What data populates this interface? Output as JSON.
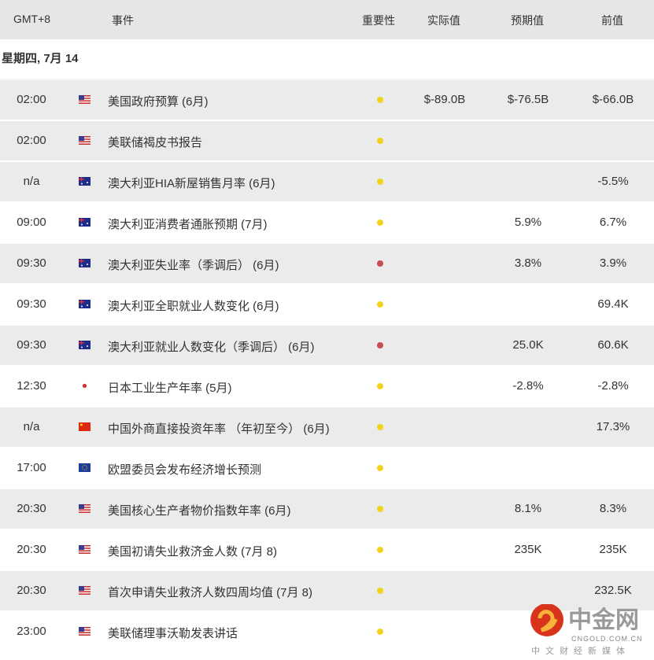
{
  "header": {
    "tz": "GMT+8",
    "event": "事件",
    "importance": "重要性",
    "actual": "实际值",
    "forecast": "预期值",
    "previous": "前值"
  },
  "date": "星期四, 7月 14",
  "colors": {
    "low": "#f2d21a",
    "high": "#c44d4d",
    "row_gray": "#ebebeb"
  },
  "rows": [
    {
      "time": "02:00",
      "flag": "us",
      "event": "美国政府预算 (6月)",
      "imp": "low",
      "actual": "$-89.0B",
      "forecast": "$-76.5B",
      "previous": "$-66.0B",
      "bg": "g"
    },
    {
      "time": "02:00",
      "flag": "us",
      "event": "美联储褐皮书报告",
      "imp": "low",
      "actual": "",
      "forecast": "",
      "previous": "",
      "bg": "g"
    },
    {
      "time": "n/a",
      "flag": "au",
      "event": "澳大利亚HIA新屋销售月率 (6月)",
      "imp": "low",
      "actual": "",
      "forecast": "",
      "previous": "-5.5%",
      "bg": "g"
    },
    {
      "time": "09:00",
      "flag": "au",
      "event": "澳大利亚消费者通胀预期 (7月)",
      "imp": "low",
      "actual": "",
      "forecast": "5.9%",
      "previous": "6.7%",
      "bg": "w"
    },
    {
      "time": "09:30",
      "flag": "au",
      "event": "澳大利亚失业率（季调后） (6月)",
      "imp": "high",
      "actual": "",
      "forecast": "3.8%",
      "previous": "3.9%",
      "bg": "g"
    },
    {
      "time": "09:30",
      "flag": "au",
      "event": "澳大利亚全职就业人数变化 (6月)",
      "imp": "low",
      "actual": "",
      "forecast": "",
      "previous": "69.4K",
      "bg": "w"
    },
    {
      "time": "09:30",
      "flag": "au",
      "event": "澳大利亚就业人数变化（季调后） (6月)",
      "imp": "high",
      "actual": "",
      "forecast": "25.0K",
      "previous": "60.6K",
      "bg": "g"
    },
    {
      "time": "12:30",
      "flag": "jp",
      "event": "日本工业生产年率 (5月)",
      "imp": "low",
      "actual": "",
      "forecast": "-2.8%",
      "previous": "-2.8%",
      "bg": "w"
    },
    {
      "time": "n/a",
      "flag": "cn",
      "event": "中国外商直接投资年率 （年初至今） (6月)",
      "imp": "low",
      "actual": "",
      "forecast": "",
      "previous": "17.3%",
      "bg": "g"
    },
    {
      "time": "17:00",
      "flag": "eu",
      "event": "欧盟委员会发布经济增长预测",
      "imp": "low",
      "actual": "",
      "forecast": "",
      "previous": "",
      "bg": "w"
    },
    {
      "time": "20:30",
      "flag": "us",
      "event": "美国核心生产者物价指数年率 (6月)",
      "imp": "low",
      "actual": "",
      "forecast": "8.1%",
      "previous": "8.3%",
      "bg": "g"
    },
    {
      "time": "20:30",
      "flag": "us",
      "event": "美国初请失业救济金人数 (7月 8)",
      "imp": "low",
      "actual": "",
      "forecast": "235K",
      "previous": "235K",
      "bg": "w"
    },
    {
      "time": "20:30",
      "flag": "us",
      "event": "首次申请失业救济人数四周均值 (7月 8)",
      "imp": "low",
      "actual": "",
      "forecast": "",
      "previous": "232.5K",
      "bg": "g"
    },
    {
      "time": "23:00",
      "flag": "us",
      "event": "美联储理事沃勒发表讲话",
      "imp": "low",
      "actual": "",
      "forecast": "",
      "previous": "",
      "bg": "w"
    }
  ],
  "watermark": {
    "name": "中金网",
    "domain": "CNGOLD.COM.CN",
    "slogan": "中文财经新媒体"
  }
}
